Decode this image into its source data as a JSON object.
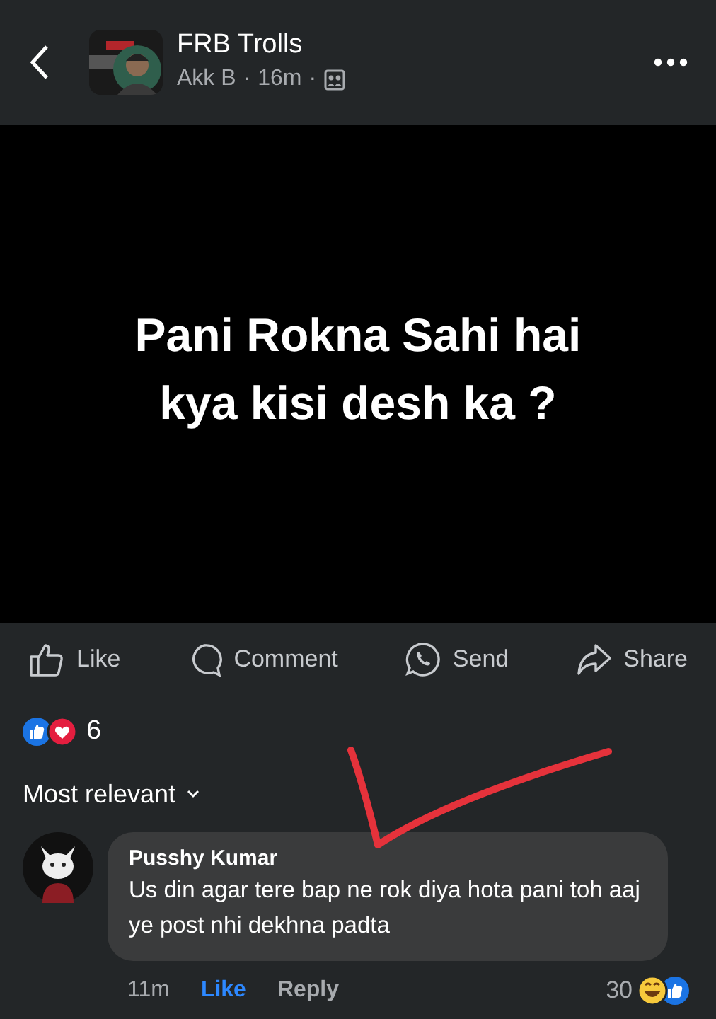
{
  "header": {
    "page_name": "FRB Trolls",
    "author": "Akk B",
    "time": "16m",
    "separator": "·"
  },
  "post": {
    "text_lines": [
      "Pani Rokna Sahi hai",
      "kya kisi desh ka ?"
    ]
  },
  "actions": [
    {
      "kind": "like",
      "label": "Like"
    },
    {
      "kind": "comment",
      "label": "Comment"
    },
    {
      "kind": "send",
      "label": "Send"
    },
    {
      "kind": "share",
      "label": "Share"
    }
  ],
  "reactions": {
    "count": "6"
  },
  "sort": {
    "label": "Most relevant"
  },
  "comments": [
    {
      "author": "Pusshy Kumar",
      "text": "Us din agar tere bap ne rok diya hota pani toh aaj ye post nhi dekhna padta",
      "time": "11m",
      "like_label": "Like",
      "liked": true,
      "reply_label": "Reply",
      "reaction_count": "30"
    }
  ]
}
